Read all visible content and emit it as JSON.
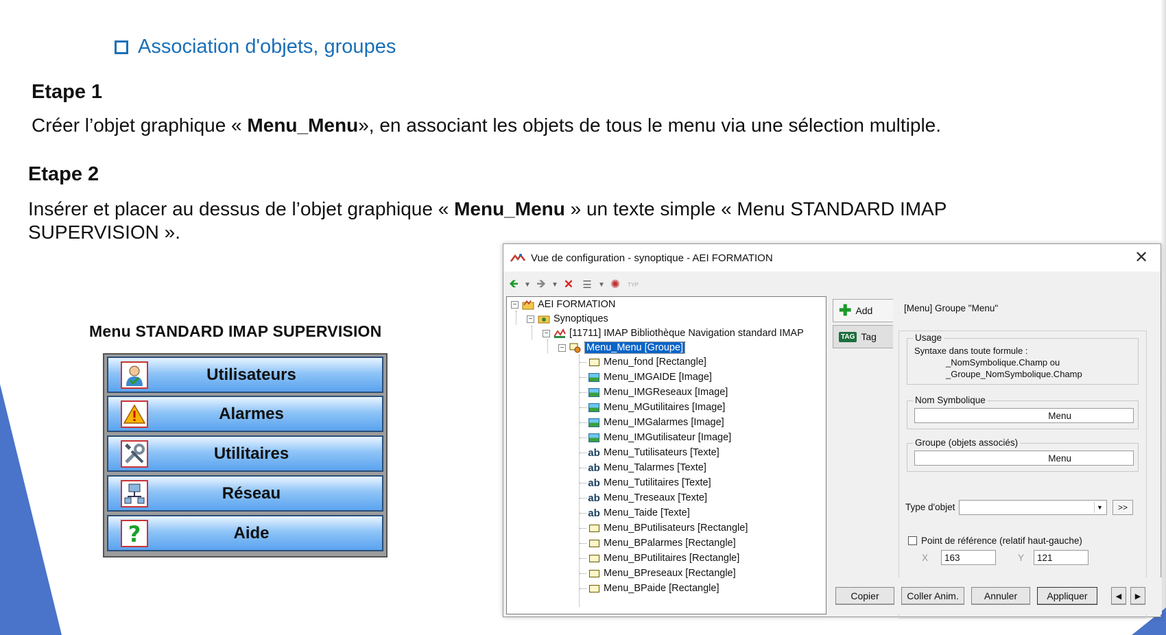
{
  "slide": {
    "bullet": "Association d'objets, groupes",
    "etape1": {
      "title": "Etape 1",
      "text_pre": "Créer l’objet graphique « ",
      "text_bold": "Menu_Menu",
      "text_post": "»,  en associant les objets de tous le menu via une sélection multiple."
    },
    "etape2": {
      "title": "Etape 2",
      "line1_pre": "Insérer et placer au dessus de l’objet graphique « ",
      "line1_bold": "Menu_Menu",
      "line1_post": " » un texte simple « Menu STANDARD IMAP",
      "line2": "SUPERVISION »."
    }
  },
  "menu": {
    "title": "Menu  STANDARD IMAP SUPERVISION",
    "buttons": [
      {
        "label": "Utilisateurs",
        "icon": "user-icon"
      },
      {
        "label": "Alarmes",
        "icon": "warning-icon"
      },
      {
        "label": "Utilitaires",
        "icon": "tools-icon"
      },
      {
        "label": "Réseau",
        "icon": "network-icon"
      },
      {
        "label": "Aide",
        "icon": "help-icon"
      }
    ]
  },
  "window": {
    "title": "Vue de configuration - synoptique - AEI FORMATION",
    "toolbar_extra": "TYP",
    "tree": {
      "root": "AEI FORMATION",
      "synoptiques": "Synoptiques",
      "library": "[11711]  IMAP Bibliothèque Navigation standard IMAP",
      "group": "Menu_Menu [Groupe]",
      "children": [
        {
          "label": "Menu_fond [Rectangle]",
          "type": "rect"
        },
        {
          "label": "Menu_IMGAIDE [Image]",
          "type": "image"
        },
        {
          "label": "Menu_IMGReseaux [Image]",
          "type": "image"
        },
        {
          "label": "Menu_MGutilitaires [Image]",
          "type": "image"
        },
        {
          "label": "Menu_IMGalarmes [Image]",
          "type": "image"
        },
        {
          "label": "Menu_IMGutilisateur [Image]",
          "type": "image"
        },
        {
          "label": "Menu_Tutilisateurs [Texte]",
          "type": "text"
        },
        {
          "label": "Menu_Talarmes [Texte]",
          "type": "text"
        },
        {
          "label": "Menu_Tutilitaires [Texte]",
          "type": "text"
        },
        {
          "label": "Menu_Treseaux [Texte]",
          "type": "text"
        },
        {
          "label": "Menu_Taide [Texte]",
          "type": "text"
        },
        {
          "label": "Menu_BPutilisateurs [Rectangle]",
          "type": "rect"
        },
        {
          "label": "Menu_BPalarmes [Rectangle]",
          "type": "rect"
        },
        {
          "label": "Menu_BPutilitaires [Rectangle]",
          "type": "rect"
        },
        {
          "label": "Menu_BPreseaux [Rectangle]",
          "type": "rect"
        },
        {
          "label": "Menu_BPaide [Rectangle]",
          "type": "rect"
        }
      ]
    },
    "tabs": {
      "add": "Add",
      "tag": "Tag",
      "tag_badge": "TAG"
    },
    "panel": {
      "header": "[Menu] Groupe  \"Menu\"",
      "usage_label": "Usage",
      "usage_line1": "Syntaxe dans toute formule :",
      "usage_line2": "_NomSymbolique.Champ      ou",
      "usage_line3": "_Groupe_NomSymbolique.Champ",
      "nom_label": "Nom Symbolique",
      "nom_value": "Menu",
      "groupe_label": "Groupe (objets associés)",
      "groupe_value": "Menu",
      "type_label": "Type d'objet",
      "type_value": "",
      "type_more": ">>",
      "ref_label": "Point de référence (relatif haut-gauche)",
      "x_label": "X",
      "x_value": "163",
      "y_label": "Y",
      "y_value": "121"
    },
    "buttons": {
      "copier": "Copier",
      "coller": "Coller Anim.",
      "annuler": "Annuler",
      "appliquer": "Appliquer",
      "prev": "◀",
      "next": "▶"
    }
  },
  "colors": {
    "accent": "#1a6fb8",
    "selection": "#0a64c8",
    "deco": "#3f6bc4"
  }
}
